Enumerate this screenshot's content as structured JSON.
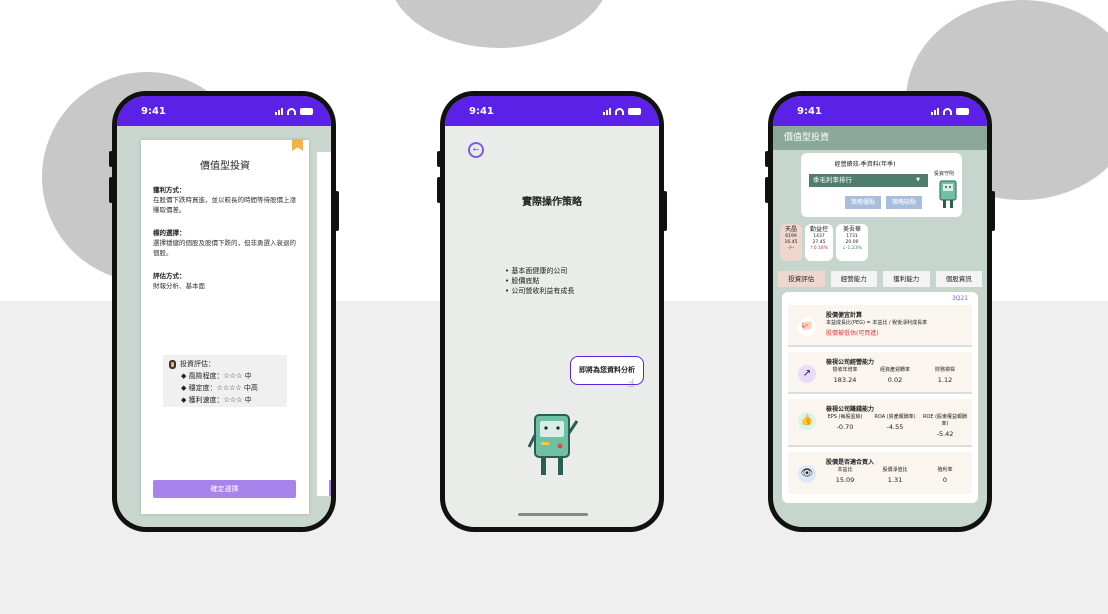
{
  "status_time": "9:41",
  "phone1": {
    "title": "價值型投資",
    "sections": [
      {
        "heading": "獲利方式：",
        "body": "在股價下跌時買進，並以較長的時間等待股價上漲賺取價差。"
      },
      {
        "heading": "標的選擇：",
        "body": "選擇穩健的個股及股價下跌的，但非勇選入衰退的個股。"
      },
      {
        "heading": "評估方式：",
        "body": "財報分析、基本面"
      }
    ],
    "eval": {
      "title": "投資評估：",
      "rows": [
        "◆ 風險程度：☆☆☆  中",
        "◆ 穩定度：☆☆☆☆ 中高",
        "◆ 獲利速度：☆☆☆ 中"
      ]
    },
    "confirm": "確定選擇"
  },
  "phone2": {
    "title": "實際操作策略",
    "items": [
      "• 基本面健康的公司",
      "• 股價底點",
      "• 公司營收利益有成長"
    ],
    "bubble": "即將為您資料分析"
  },
  "phone3": {
    "header": "價值型投資",
    "card_title": "經營績效-季資料(年季)",
    "select_value": "季毛利率排行",
    "btn_adv": "策略優點",
    "btn_dis": "策略缺點",
    "guard": "投資守則",
    "stocks": [
      {
        "name": "天晶",
        "code": "6199",
        "price": "16.45",
        "chg": "-/--"
      },
      {
        "name": "勤益控",
        "code": "1437",
        "price": "27.45",
        "chg": "↑0.18%"
      },
      {
        "name": "美吾華",
        "code": "1731",
        "price": "20.00",
        "chg": "↓-1.23%"
      }
    ],
    "tabs": [
      "投資評估",
      "經營能力",
      "獲利能力",
      "個股資訊"
    ],
    "quarter": "3Q21",
    "blocks": [
      {
        "icon": "piggy-icon",
        "title": "股價便宜計算",
        "sub": "本益成長比(PEG) = 本益比 / 稅後淨利成長率",
        "result": "股價被低估(可買進)"
      },
      {
        "icon": "trend-icon",
        "title": "檢視公司經營能力",
        "cols": [
          [
            "營收年增率",
            "183.24"
          ],
          [
            "經資產週轉率",
            "0.02"
          ],
          [
            "財務槓桿",
            "1.12"
          ]
        ]
      },
      {
        "icon": "thumb-icon",
        "title": "檢視公司賺錢能力",
        "cols": [
          [
            "EPS (每股盈餘)",
            "-0.70"
          ],
          [
            "ROA (資產報酬率)",
            "-4.55"
          ],
          [
            "ROE (股東權益報酬率)",
            "-5.42"
          ]
        ]
      },
      {
        "icon": "eye-icon",
        "title": "股價是否適合買入",
        "cols": [
          [
            "本益比",
            "15.09"
          ],
          [
            "股價淨值比",
            "1.31"
          ],
          [
            "殖利率",
            "0"
          ]
        ]
      }
    ]
  },
  "colors": {
    "accent": "#5b21e6",
    "button": "#a983ec",
    "select": "#4e7d6c",
    "header": "#8ba89a"
  }
}
